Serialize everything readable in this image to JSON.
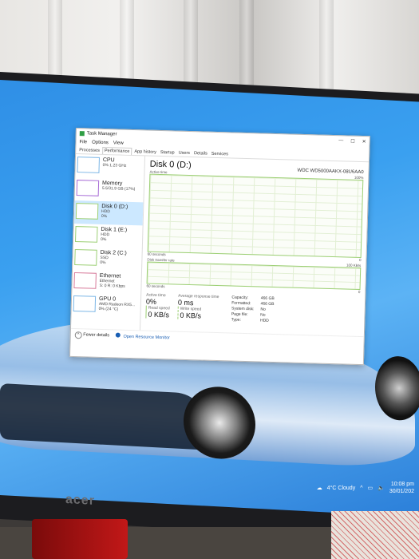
{
  "window": {
    "title": "Task Manager",
    "controls": [
      "—",
      "☐",
      "✕"
    ]
  },
  "menu": [
    "File",
    "Options",
    "View"
  ],
  "tabs": [
    "Processes",
    "Performance",
    "App history",
    "Startup",
    "Users",
    "Details",
    "Services"
  ],
  "sidebar": [
    {
      "name": "CPU",
      "sub1": "0% 1.23 GHz",
      "sub2": "",
      "kind": "cpu"
    },
    {
      "name": "Memory",
      "sub1": "5.5/31.9 GB (17%)",
      "sub2": "",
      "kind": "mem"
    },
    {
      "name": "Disk 0 (D:)",
      "sub1": "HDD",
      "sub2": "0%",
      "kind": "disk",
      "selected": true
    },
    {
      "name": "Disk 1 (E:)",
      "sub1": "HDD",
      "sub2": "0%",
      "kind": "disk"
    },
    {
      "name": "Disk 2 (C:)",
      "sub1": "SSD",
      "sub2": "0%",
      "kind": "disk"
    },
    {
      "name": "Ethernet",
      "sub1": "Ethernet",
      "sub2": "S: 0 R: 0 Kbps",
      "kind": "eth"
    },
    {
      "name": "GPU 0",
      "sub1": "AMD Radeon RX5...",
      "sub2": "0% (24 °C)",
      "kind": "gpu"
    }
  ],
  "detail": {
    "title": "Disk 0 (D:)",
    "model": "WDC WD5000AAKX-08U6AA0",
    "graph1": {
      "label": "Active time",
      "max": "100%",
      "duration": "60 seconds",
      "min": "0"
    },
    "graph2": {
      "label": "Disk transfer rate",
      "max": "100 KB/s",
      "duration": "60 seconds",
      "min": "0"
    },
    "active_time_label": "Active time",
    "active_time_value": "0%",
    "response_label": "Average response time",
    "response_value": "0 ms",
    "read_label": "Read speed",
    "read_value": "0 KB/s",
    "write_label": "Write speed",
    "write_value": "0 KB/s",
    "props": [
      {
        "k": "Capacity:",
        "v": "466 GB"
      },
      {
        "k": "Formatted:",
        "v": "466 GB"
      },
      {
        "k": "System disk:",
        "v": "No"
      },
      {
        "k": "Page file:",
        "v": "No"
      },
      {
        "k": "Type:",
        "v": "HDD"
      }
    ]
  },
  "footer": {
    "fewer": "Fewer details",
    "monitor": "Open Resource Monitor"
  },
  "taskbar": {
    "weather": "4°C Cloudy",
    "time": "10:08 pm",
    "date": "30/01/202"
  },
  "monitor_brand": "acer"
}
